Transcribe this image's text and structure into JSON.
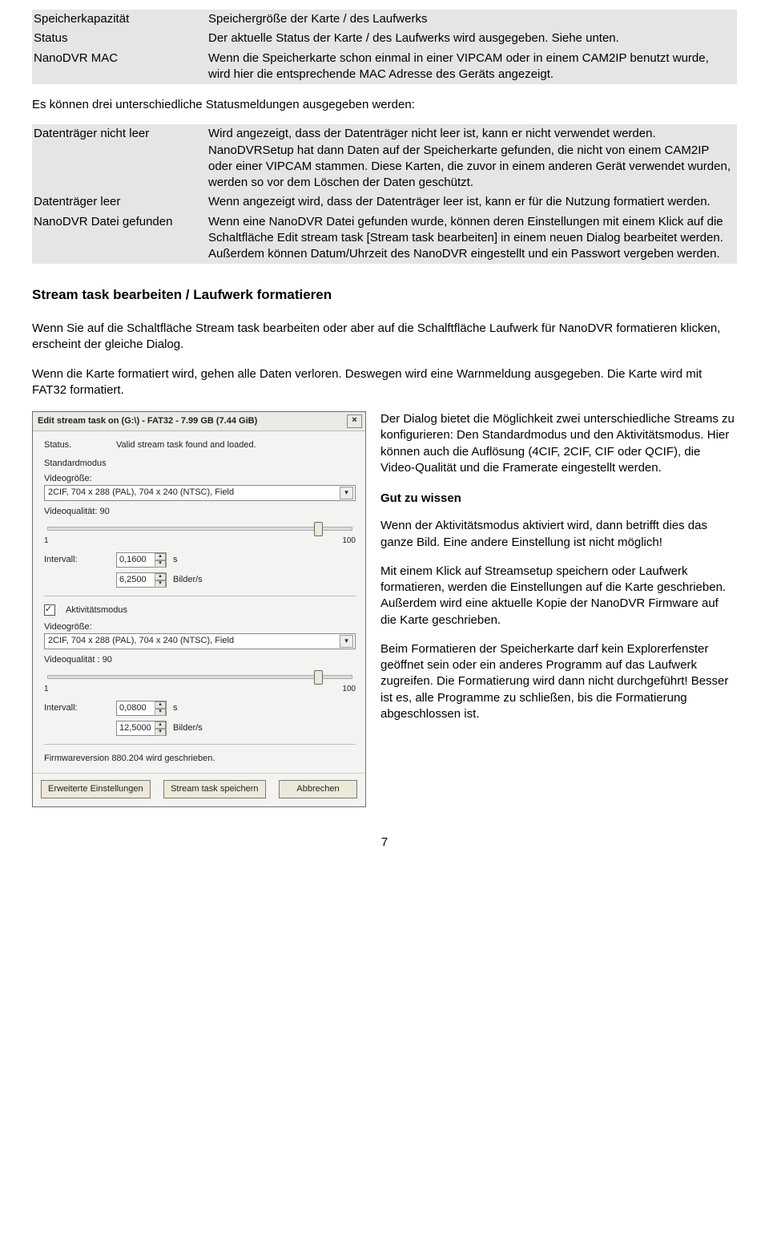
{
  "table1": {
    "speicherkapazitaet_k": "Speicherkapazität",
    "speicherkapazitaet_v": "Speichergröße der Karte / des Laufwerks",
    "status_k": "Status",
    "status_v": "Der aktuelle Status der Karte / des Laufwerks wird ausgegeben. Siehe unten.",
    "nanodvr_mac_k": "NanoDVR MAC",
    "nanodvr_mac_v": "Wenn die Speicherkarte schon einmal in einer VIPCAM oder in einem CAM2IP benutzt wurde, wird hier die entsprechende MAC Adresse des Geräts angezeigt."
  },
  "intertext": "Es können drei unterschiedliche Statusmeldungen ausgegeben werden:",
  "table2": {
    "nichtleer_k": "Datenträger nicht leer",
    "nichtleer_v": "Wird angezeigt, dass der Datenträger nicht leer ist, kann er nicht verwendet werden. NanoDVRSetup hat dann Daten auf der Speicherkarte gefunden, die nicht von einem CAM2IP oder einer VIPCAM stammen. Diese Karten, die zuvor in einem anderen Gerät verwendet wurden, werden so vor dem Löschen der Daten geschützt.",
    "leer_k": "Datenträger leer",
    "leer_v": "Wenn angezeigt wird, dass der Datenträger leer ist, kann er für die Nutzung formatiert werden.",
    "gefunden_k": "NanoDVR Datei gefunden",
    "gefunden_v": "Wenn eine NanoDVR Datei gefunden wurde, können deren Einstellungen mit einem Klick auf die Schaltfläche Edit stream task [Stream task bearbeiten] in einem neuen Dialog bearbeitet werden. Außerdem können Datum/Uhrzeit des NanoDVR eingestellt und ein Passwort vergeben werden."
  },
  "section_title": "Stream task bearbeiten / Laufwerk formatieren",
  "para1": "Wenn Sie auf die Schaltfläche Stream task bearbeiten oder aber auf die Schalftfläche Laufwerk für NanoDVR formatieren klicken, erscheint der gleiche Dialog.",
  "para2a": "Wenn die Karte formatiert wird, gehen alle Daten verloren. Deswegen wird eine Warnmeldung ausgegeben. Die Karte wird mit FAT32 formatiert.",
  "para2b": "Der Dialog bietet die Möglichkeit zwei unterschiedliche Streams zu konfigurieren: Den Standardmodus und den Aktivitätsmodus. Hier können auch die Auflösung (4CIF, 2CIF, CIF oder QCIF), die Video-Qualität und die Framerate eingestellt werden.",
  "gut_zu_wissen": "Gut zu wissen",
  "para3": "Wenn der Aktivitätsmodus aktiviert wird, dann betrifft dies das ganze Bild. Eine andere Einstellung ist nicht möglich!",
  "para4": "Mit einem Klick auf Streamsetup speichern oder Laufwerk formatieren, werden die Einstellungen auf die Karte geschrieben. Außerdem wird eine aktuelle Kopie der NanoDVR Firmware auf die Karte geschrieben.",
  "para5": "Beim Formatieren der Speicherkarte darf kein Explorerfenster geöffnet sein oder ein anderes Programm auf das Laufwerk zugreifen. Die Formatierung wird dann nicht durchgeführt! Besser ist es, alle Programme zu schließen, bis die Formatierung abgeschlossen ist.",
  "dialog": {
    "title": "Edit stream task on  (G:\\)  -  FAT32  -  7.99 GB (7.44 GiB)",
    "close": "×",
    "status_label": "Status.",
    "status_value": "Valid stream task found and loaded.",
    "std_mode": "Standardmodus",
    "video_groesse": "Videogröße:",
    "combo_value": "2CIF, 704 x 288 (PAL), 704 x 240 (NTSC), Field",
    "video_qual": "Videoqualität: 90",
    "scale_min": "1",
    "scale_max": "100",
    "intervall": "Intervall:",
    "std_sec": "0,1600",
    "std_fps": "6,2500",
    "unit_s": "s",
    "unit_fps": "Bilder/s",
    "akt_mode": "Aktivitätsmodus",
    "akt_video_qual": "Videoqualität : 90",
    "akt_sec": "0,0800",
    "akt_fps": "12,5000",
    "firmware": "Firmwareversion 880.204 wird geschrieben.",
    "btn_adv": "Erweiterte Einstellungen",
    "btn_save": "Stream task speichern",
    "btn_cancel": "Abbrechen"
  },
  "pagenum": "7"
}
